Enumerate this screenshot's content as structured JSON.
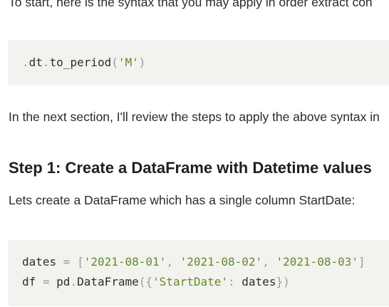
{
  "intro_text": "To start, here is the syntax that you may apply in order extract con",
  "code_block_1": {
    "line_1": {
      "dot": ".",
      "dt": "dt",
      "dot2": ".",
      "method": "to_period",
      "open_paren": "(",
      "arg": "'M'",
      "close_paren": ")"
    }
  },
  "next_section_text": "In the next section, I'll review the steps to apply the above syntax in",
  "step1_heading": "Step 1: Create a DataFrame with Datetime values",
  "lets_create_text": "Lets create a DataFrame which has a single column StartDate:",
  "code_block_2": {
    "line_1": {
      "var": "dates",
      "eq": " = ",
      "open_bracket": "[",
      "str1": "'2021-08-01'",
      "comma1": ", ",
      "str2": "'2021-08-02'",
      "comma2": ", ",
      "str3": "'2021-08-03'",
      "close_bracket": "]"
    },
    "line_2": {
      "var": "df",
      "eq": " = ",
      "module": "pd",
      "dot": ".",
      "class_name": "DataFrame",
      "open": "({",
      "key": "'StartDate'",
      "colon": ": ",
      "value": "dates",
      "close": "})"
    }
  }
}
